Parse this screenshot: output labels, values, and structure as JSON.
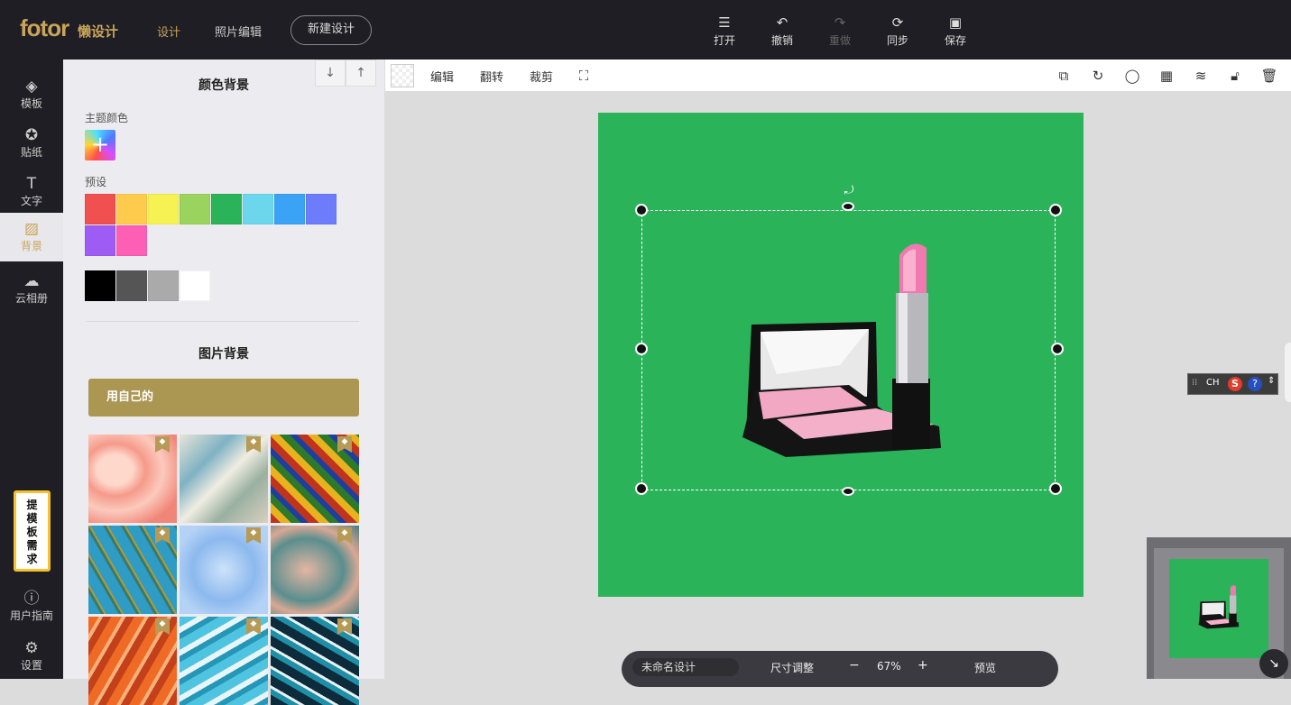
{
  "topbar": {
    "logo": "fotor",
    "logo_sub": "懒设计",
    "nav": [
      "设计",
      "照片编辑"
    ],
    "new_design": "新建设计",
    "tools": [
      {
        "icon": "menu-icon",
        "label": "打开",
        "enabled": true
      },
      {
        "icon": "undo-icon",
        "label": "撤销",
        "enabled": true
      },
      {
        "icon": "redo-icon",
        "label": "重做",
        "enabled": false
      },
      {
        "icon": "sync-icon",
        "label": "同步",
        "enabled": true
      },
      {
        "icon": "save-icon",
        "label": "保存",
        "enabled": true
      }
    ]
  },
  "sidebar": {
    "items": [
      {
        "icon": "layers-icon",
        "label": "模板"
      },
      {
        "icon": "sticker-icon",
        "label": "贴纸"
      },
      {
        "icon": "text-icon",
        "label": "文字"
      },
      {
        "icon": "background-icon",
        "label": "背景",
        "active": true
      },
      {
        "icon": "cloud-icon",
        "label": "云相册"
      }
    ],
    "request_template": "提模板需求",
    "guide": "用户指南",
    "settings": "设置"
  },
  "panel": {
    "arrow_down": "↓",
    "arrow_up": "↑",
    "color_bg_title": "颜色背景",
    "theme_color_label": "主题颜色",
    "preset_label": "预设",
    "preset_colors": [
      "#f05050",
      "#ffcb4d",
      "#f7f253",
      "#9ad35e",
      "#2bb35a",
      "#6cd7ec",
      "#3aa3f5",
      "#6c7cfa",
      "#9f5cf5",
      "#fd5fb4"
    ],
    "gray_colors": [
      "#000000",
      "#555555",
      "#aaaaaa",
      "#ffffff"
    ],
    "image_bg_title": "图片背景",
    "use_own": "用自己的"
  },
  "toolbar": {
    "edit": "编辑",
    "flip": "翻转",
    "crop": "裁剪"
  },
  "bottombar": {
    "doc_name": "未命名设计",
    "resize": "尺寸调整",
    "minus": "−",
    "zoom": "67%",
    "plus": "+",
    "preview": "预览"
  },
  "ime": {
    "lang": "CH"
  }
}
